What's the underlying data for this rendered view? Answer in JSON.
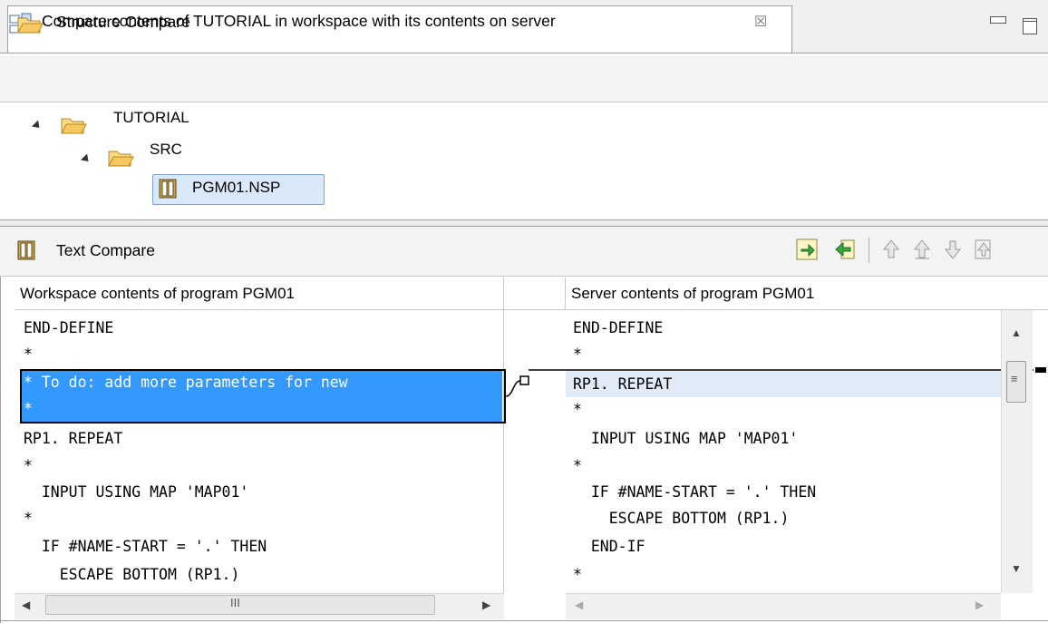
{
  "window": {
    "tab_title": "Compare contents of TUTORIAL in workspace with its contents on server",
    "close_glyph": "☒"
  },
  "structure_compare": {
    "title": "Structure Compare",
    "tree": {
      "root": "TUTORIAL",
      "folder": "SRC",
      "file": "PGM01.NSP"
    }
  },
  "text_compare": {
    "title": "Text Compare",
    "left_header": "Workspace contents of program PGM01",
    "right_header": "Server contents of program PGM01",
    "left_lines": [
      "END-DEFINE",
      "*",
      "* To do: add more parameters for new",
      "*",
      "RP1. REPEAT",
      "*",
      "  INPUT USING MAP 'MAP01'",
      "*",
      "  IF #NAME-START = '.' THEN",
      "    ESCAPE BOTTOM (RP1.)"
    ],
    "right_lines": [
      "END-DEFINE",
      "*",
      "RP1. REPEAT",
      "*",
      "  INPUT USING MAP 'MAP01'",
      "*",
      "  IF #NAME-START = '.' THEN",
      "    ESCAPE BOTTOM (RP1.)",
      "  END-IF",
      "*"
    ],
    "hscroll_grip": "III"
  },
  "icons": {
    "tab": "compare-editor-icon",
    "structure": "folder-open-icon",
    "text": "text-compare-icon",
    "toolbar": [
      "copy-left-to-right-icon",
      "copy-current-change-icon",
      "next-difference-icon",
      "previous-difference-icon",
      "next-change-icon",
      "previous-change-icon"
    ]
  },
  "colors": {
    "selection": "#3399ff",
    "diff_highlight": "#e1ebf8",
    "folder": "#f6c85f"
  }
}
